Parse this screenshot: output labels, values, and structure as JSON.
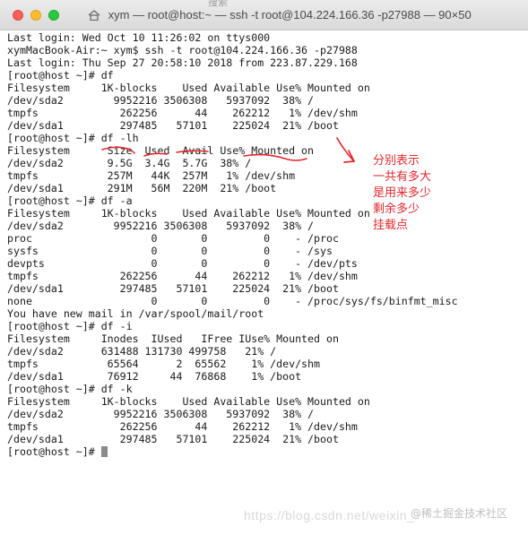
{
  "window": {
    "title": "xym — root@host:~ — ssh -t root@104.224.166.36 -p27988 — 90×50",
    "background_tab_label": "搜索"
  },
  "terminal": {
    "lines": [
      "Last login: Wed Oct 10 11:26:02 on ttys000",
      "xymMacBook-Air:~ xym$ ssh -t root@104.224.166.36 -p27988",
      "Last login: Thu Sep 27 20:58:10 2018 from 223.87.229.168",
      "[root@host ~]# df",
      "Filesystem     1K-blocks    Used Available Use% Mounted on",
      "/dev/sda2        9952216 3506308   5937092  38% /",
      "tmpfs             262256      44    262212   1% /dev/shm",
      "/dev/sda1         297485   57101    225024  21% /boot",
      "[root@host ~]# df -lh",
      "Filesystem      Size  Used  Avail Use% Mounted on",
      "/dev/sda2       9.5G  3.4G  5.7G  38% /",
      "tmpfs           257M   44K  257M   1% /dev/shm",
      "/dev/sda1       291M   56M  220M  21% /boot",
      "[root@host ~]# df -a",
      "Filesystem     1K-blocks    Used Available Use% Mounted on",
      "/dev/sda2        9952216 3506308   5937092  38% /",
      "proc                   0       0         0    - /proc",
      "sysfs                  0       0         0    - /sys",
      "devpts                 0       0         0    - /dev/pts",
      "tmpfs             262256      44    262212   1% /dev/shm",
      "/dev/sda1         297485   57101    225024  21% /boot",
      "none                   0       0         0    - /proc/sys/fs/binfmt_misc",
      "You have new mail in /var/spool/mail/root",
      "[root@host ~]# df -i",
      "Filesystem     Inodes  IUsed   IFree IUse% Mounted on",
      "/dev/sda2      631488 131730 499758   21% /",
      "tmpfs           65564      2  65562    1% /dev/shm",
      "/dev/sda1       76912     44  76868    1% /boot",
      "[root@host ~]# df -k",
      "Filesystem     1K-blocks    Used Available Use% Mounted on",
      "/dev/sda2        9952216 3506308   5937092  38% /",
      "tmpfs             262256      44    262212   1% /dev/shm",
      "/dev/sda1         297485   57101    225024  21% /boot"
    ],
    "prompt": "[root@host ~]# "
  },
  "annotation": {
    "color": "#e0282e",
    "lines": [
      "分别表示",
      "一共有多大",
      "是用来多少",
      "剩余多少",
      "挂载点"
    ]
  },
  "watermark": {
    "url": "https://blog.csdn.net/weixin_",
    "badge": "@稀土掘金技术社区"
  },
  "colors": {
    "titlebar": "#e2e2e2",
    "terminal_text": "#1a1a1a",
    "close": "#fc5f57",
    "minimize": "#fdbc2e",
    "zoom": "#28c840"
  }
}
